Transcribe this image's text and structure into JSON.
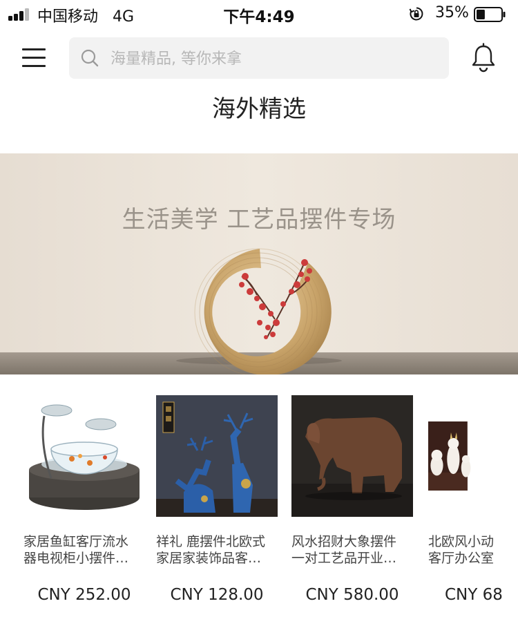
{
  "status_bar": {
    "carrier": "中国移动",
    "network": "4G",
    "time": "下午4:49",
    "battery_percent": "35%",
    "battery_level": 0.35
  },
  "nav": {
    "search_placeholder": "海量精品, 等你来拿",
    "menu_icon": "hamburger-menu-icon",
    "bell_icon": "bell-icon",
    "search_icon": "search-icon"
  },
  "page_title": "海外精选",
  "banner": {
    "headline": "生活美学 工艺品摆件专场"
  },
  "products": [
    {
      "name_line1": "家居鱼缸客厅流水",
      "name_line2": "器电视柜小摆件…",
      "price": "CNY 252.00",
      "image": "glass-fish-tank-fountain"
    },
    {
      "name_line1": "祥礼 鹿摆件北欧式",
      "name_line2": "家居家装饰品客…",
      "price": "CNY 128.00",
      "image": "blue-deer-figurines"
    },
    {
      "name_line1": "风水招财大象摆件",
      "name_line2": "一对工艺品开业…",
      "price": "CNY 580.00",
      "image": "bronze-elephant-statue"
    },
    {
      "name_line1": "北欧风小动",
      "name_line2": "客厅办公室",
      "price": "CNY 68",
      "image": "white-ceramic-animals"
    }
  ],
  "colors": {
    "search_bg": "#f2f2f2",
    "banner_wall": "#ebe4da",
    "banner_table": "#8a8176",
    "text_dark": "#222222"
  }
}
